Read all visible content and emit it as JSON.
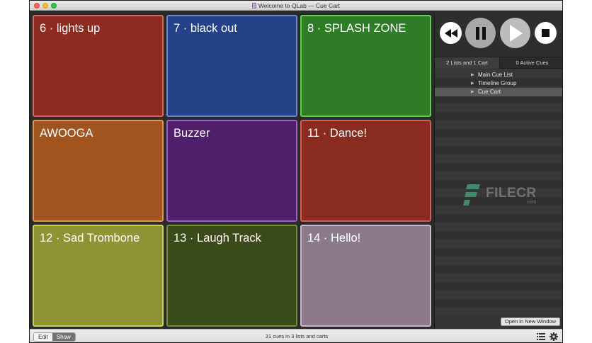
{
  "window": {
    "title": "Welcome to QLab — Cue Cart"
  },
  "cart": {
    "tiles": [
      {
        "label": "6 · lights up",
        "fill": "#8f2a20",
        "border": "#d06a5e"
      },
      {
        "label": "7 · black out",
        "fill": "#24418a",
        "border": "#6a86d0"
      },
      {
        "label": "8 · SPLASH ZONE",
        "fill": "#2e7d26",
        "border": "#5fcf4d"
      },
      {
        "label": "AWOOGA",
        "fill": "#a05520",
        "border": "#e0934e"
      },
      {
        "label": "Buzzer",
        "fill": "#4f1f6b",
        "border": "#a05cc8"
      },
      {
        "label": "11 · Dance!",
        "fill": "#8a2b20",
        "border": "#cf5f52"
      },
      {
        "label": "12 · Sad Trombone",
        "fill": "#8c9433",
        "border": "#c8d05b"
      },
      {
        "label": "13 · Laugh Track",
        "fill": "#3a4a18",
        "border": "#738a3a"
      },
      {
        "label": "14 · Hello!",
        "fill": "#8b7a8c",
        "border": "#c8b7c9"
      }
    ]
  },
  "sidebar": {
    "tabs": [
      {
        "label": "2 Lists and 1 Cart"
      },
      {
        "label": "0 Active Cues"
      }
    ],
    "lists": [
      {
        "label": "Main Cue List"
      },
      {
        "label": "Timeline Group"
      },
      {
        "label": "Cue Cart"
      }
    ],
    "open_window_label": "Open in New Window",
    "watermark": {
      "text": "FILECR",
      "sub": ".com"
    }
  },
  "footer": {
    "edit_label": "Edit",
    "show_label": "Show",
    "status": "31 cues in 3 lists and carts"
  },
  "icons": {
    "rewind": "rewind-icon",
    "pause": "pause-icon",
    "play": "play-icon",
    "stop": "stop-icon",
    "list": "list-icon",
    "gear": "gear-icon"
  }
}
